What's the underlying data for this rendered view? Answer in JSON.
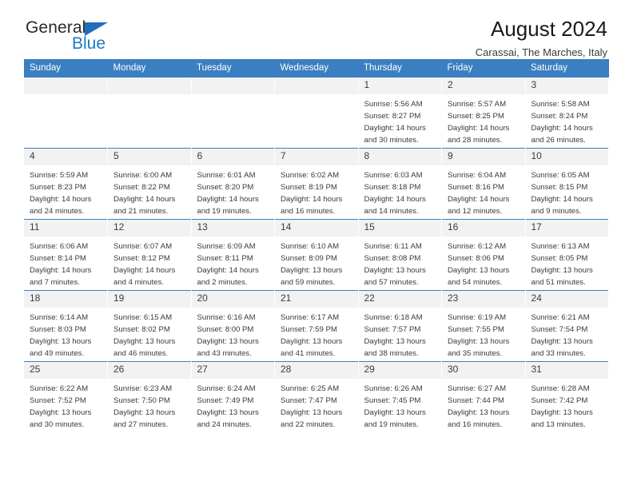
{
  "brand": {
    "name_top": "General",
    "name_bottom": "Blue",
    "triangle_color": "#1f6fbb",
    "blue_color": "#1f7ac0"
  },
  "header": {
    "title": "August 2024",
    "subtitle": "Carassai, The Marches, Italy"
  },
  "theme": {
    "header_bg": "#3a7fc1",
    "daynum_bg": "#f2f2f2",
    "text": "#3a3a3a"
  },
  "weekdays": [
    "Sunday",
    "Monday",
    "Tuesday",
    "Wednesday",
    "Thursday",
    "Friday",
    "Saturday"
  ],
  "labels": {
    "sunrise": "Sunrise:",
    "sunset": "Sunset:",
    "daylight": "Daylight:"
  },
  "weeks": [
    [
      {
        "day": "",
        "sunrise": "",
        "sunset": "",
        "daylight": ""
      },
      {
        "day": "",
        "sunrise": "",
        "sunset": "",
        "daylight": ""
      },
      {
        "day": "",
        "sunrise": "",
        "sunset": "",
        "daylight": ""
      },
      {
        "day": "",
        "sunrise": "",
        "sunset": "",
        "daylight": ""
      },
      {
        "day": "1",
        "sunrise": "Sunrise: 5:56 AM",
        "sunset": "Sunset: 8:27 PM",
        "daylight": "Daylight: 14 hours and 30 minutes."
      },
      {
        "day": "2",
        "sunrise": "Sunrise: 5:57 AM",
        "sunset": "Sunset: 8:25 PM",
        "daylight": "Daylight: 14 hours and 28 minutes."
      },
      {
        "day": "3",
        "sunrise": "Sunrise: 5:58 AM",
        "sunset": "Sunset: 8:24 PM",
        "daylight": "Daylight: 14 hours and 26 minutes."
      }
    ],
    [
      {
        "day": "4",
        "sunrise": "Sunrise: 5:59 AM",
        "sunset": "Sunset: 8:23 PM",
        "daylight": "Daylight: 14 hours and 24 minutes."
      },
      {
        "day": "5",
        "sunrise": "Sunrise: 6:00 AM",
        "sunset": "Sunset: 8:22 PM",
        "daylight": "Daylight: 14 hours and 21 minutes."
      },
      {
        "day": "6",
        "sunrise": "Sunrise: 6:01 AM",
        "sunset": "Sunset: 8:20 PM",
        "daylight": "Daylight: 14 hours and 19 minutes."
      },
      {
        "day": "7",
        "sunrise": "Sunrise: 6:02 AM",
        "sunset": "Sunset: 8:19 PM",
        "daylight": "Daylight: 14 hours and 16 minutes."
      },
      {
        "day": "8",
        "sunrise": "Sunrise: 6:03 AM",
        "sunset": "Sunset: 8:18 PM",
        "daylight": "Daylight: 14 hours and 14 minutes."
      },
      {
        "day": "9",
        "sunrise": "Sunrise: 6:04 AM",
        "sunset": "Sunset: 8:16 PM",
        "daylight": "Daylight: 14 hours and 12 minutes."
      },
      {
        "day": "10",
        "sunrise": "Sunrise: 6:05 AM",
        "sunset": "Sunset: 8:15 PM",
        "daylight": "Daylight: 14 hours and 9 minutes."
      }
    ],
    [
      {
        "day": "11",
        "sunrise": "Sunrise: 6:06 AM",
        "sunset": "Sunset: 8:14 PM",
        "daylight": "Daylight: 14 hours and 7 minutes."
      },
      {
        "day": "12",
        "sunrise": "Sunrise: 6:07 AM",
        "sunset": "Sunset: 8:12 PM",
        "daylight": "Daylight: 14 hours and 4 minutes."
      },
      {
        "day": "13",
        "sunrise": "Sunrise: 6:09 AM",
        "sunset": "Sunset: 8:11 PM",
        "daylight": "Daylight: 14 hours and 2 minutes."
      },
      {
        "day": "14",
        "sunrise": "Sunrise: 6:10 AM",
        "sunset": "Sunset: 8:09 PM",
        "daylight": "Daylight: 13 hours and 59 minutes."
      },
      {
        "day": "15",
        "sunrise": "Sunrise: 6:11 AM",
        "sunset": "Sunset: 8:08 PM",
        "daylight": "Daylight: 13 hours and 57 minutes."
      },
      {
        "day": "16",
        "sunrise": "Sunrise: 6:12 AM",
        "sunset": "Sunset: 8:06 PM",
        "daylight": "Daylight: 13 hours and 54 minutes."
      },
      {
        "day": "17",
        "sunrise": "Sunrise: 6:13 AM",
        "sunset": "Sunset: 8:05 PM",
        "daylight": "Daylight: 13 hours and 51 minutes."
      }
    ],
    [
      {
        "day": "18",
        "sunrise": "Sunrise: 6:14 AM",
        "sunset": "Sunset: 8:03 PM",
        "daylight": "Daylight: 13 hours and 49 minutes."
      },
      {
        "day": "19",
        "sunrise": "Sunrise: 6:15 AM",
        "sunset": "Sunset: 8:02 PM",
        "daylight": "Daylight: 13 hours and 46 minutes."
      },
      {
        "day": "20",
        "sunrise": "Sunrise: 6:16 AM",
        "sunset": "Sunset: 8:00 PM",
        "daylight": "Daylight: 13 hours and 43 minutes."
      },
      {
        "day": "21",
        "sunrise": "Sunrise: 6:17 AM",
        "sunset": "Sunset: 7:59 PM",
        "daylight": "Daylight: 13 hours and 41 minutes."
      },
      {
        "day": "22",
        "sunrise": "Sunrise: 6:18 AM",
        "sunset": "Sunset: 7:57 PM",
        "daylight": "Daylight: 13 hours and 38 minutes."
      },
      {
        "day": "23",
        "sunrise": "Sunrise: 6:19 AM",
        "sunset": "Sunset: 7:55 PM",
        "daylight": "Daylight: 13 hours and 35 minutes."
      },
      {
        "day": "24",
        "sunrise": "Sunrise: 6:21 AM",
        "sunset": "Sunset: 7:54 PM",
        "daylight": "Daylight: 13 hours and 33 minutes."
      }
    ],
    [
      {
        "day": "25",
        "sunrise": "Sunrise: 6:22 AM",
        "sunset": "Sunset: 7:52 PM",
        "daylight": "Daylight: 13 hours and 30 minutes."
      },
      {
        "day": "26",
        "sunrise": "Sunrise: 6:23 AM",
        "sunset": "Sunset: 7:50 PM",
        "daylight": "Daylight: 13 hours and 27 minutes."
      },
      {
        "day": "27",
        "sunrise": "Sunrise: 6:24 AM",
        "sunset": "Sunset: 7:49 PM",
        "daylight": "Daylight: 13 hours and 24 minutes."
      },
      {
        "day": "28",
        "sunrise": "Sunrise: 6:25 AM",
        "sunset": "Sunset: 7:47 PM",
        "daylight": "Daylight: 13 hours and 22 minutes."
      },
      {
        "day": "29",
        "sunrise": "Sunrise: 6:26 AM",
        "sunset": "Sunset: 7:45 PM",
        "daylight": "Daylight: 13 hours and 19 minutes."
      },
      {
        "day": "30",
        "sunrise": "Sunrise: 6:27 AM",
        "sunset": "Sunset: 7:44 PM",
        "daylight": "Daylight: 13 hours and 16 minutes."
      },
      {
        "day": "31",
        "sunrise": "Sunrise: 6:28 AM",
        "sunset": "Sunset: 7:42 PM",
        "daylight": "Daylight: 13 hours and 13 minutes."
      }
    ]
  ]
}
